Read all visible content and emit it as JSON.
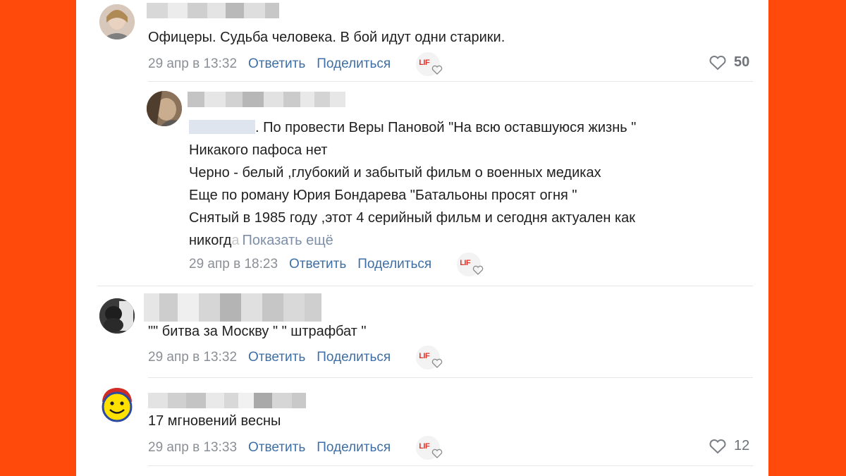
{
  "comments": [
    {
      "text": "Офицеры. Судьба человека. В бой идут одни старики.",
      "date": "29 апр в 13:32",
      "reply": "Ответить",
      "share": "Поделиться",
      "lif": "LIF",
      "likes": "50"
    },
    {
      "mention": "",
      "lines": [
        ". По провести Веры Пановой \"На всю оставшуюся жизнь \"",
        "Никакого пафоса нет",
        "Черно - белый ,глубокий и забытый фильм о военных медиках",
        "Еще по роману Юрия Бондарева \"Батальоны просят огня \"",
        "Снятый в 1985 году ,этот 4 серийный фильм и сегодня актуален как",
        "никогд"
      ],
      "truncated_tail": "а",
      "show_more": "Показать ещё",
      "date": "29 апр в 18:23",
      "reply": "Ответить",
      "share": "Поделиться",
      "lif": "LIF"
    },
    {
      "text": "\"\" битва за Москву \" \" штрафбат \"",
      "date": "29 апр в 13:32",
      "reply": "Ответить",
      "share": "Поделиться",
      "lif": "LIF"
    },
    {
      "text": "17 мгновений весны",
      "date": "29 апр в 13:33",
      "reply": "Ответить",
      "share": "Поделиться",
      "lif": "LIF",
      "likes": "12"
    }
  ],
  "colors": {
    "background": "#ff4a0b",
    "link": "#3d6fa6",
    "meta": "#8a8f96"
  }
}
